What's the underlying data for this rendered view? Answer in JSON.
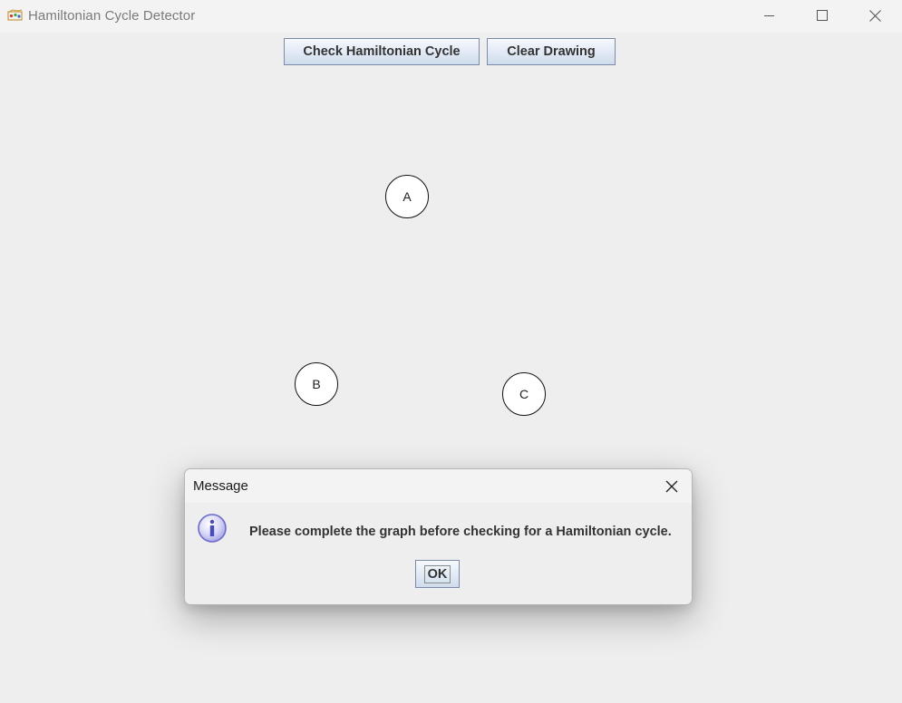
{
  "window": {
    "title": "Hamiltonian Cycle Detector",
    "controls": {
      "minimize": "minimize-icon",
      "maximize": "maximize-icon",
      "close": "close-icon"
    }
  },
  "toolbar": {
    "check_label": "Check Hamiltonian Cycle",
    "clear_label": "Clear Drawing"
  },
  "graph": {
    "nodes": [
      {
        "label": "A"
      },
      {
        "label": "B"
      },
      {
        "label": "C"
      }
    ]
  },
  "dialog": {
    "title": "Message",
    "icon": "info-icon",
    "message": "Please complete the graph before checking for a Hamiltonian cycle.",
    "ok_label": "OK"
  },
  "colors": {
    "background": "#eeeeee",
    "titlebar": "#f3f3f3",
    "button_border": "#7a8aa8",
    "info_icon": "#6a6ad0"
  }
}
